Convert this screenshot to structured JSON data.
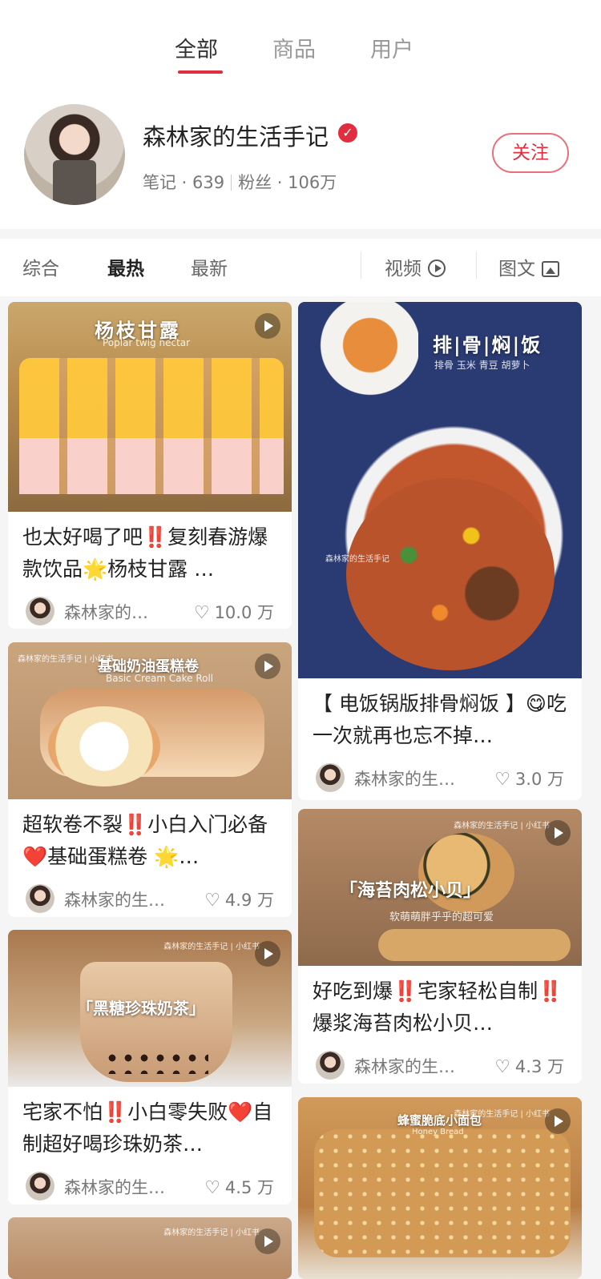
{
  "top_tabs": [
    "全部",
    "商品",
    "用户"
  ],
  "user": {
    "name": "森林家的生活手记",
    "verified_icon": "✓",
    "notes_label": "笔记 · 639",
    "fans_label": "粉丝 · 106万",
    "follow_label": "关注"
  },
  "sort": {
    "items": [
      "综合",
      "最热",
      "最新"
    ],
    "video_label": "视频",
    "image_text_label": "图文"
  },
  "cards": [
    {
      "cover_title": "杨枝甘露",
      "cover_sub": "Poplar twig nectar",
      "title": "也太好喝了吧‼️复刻春游爆款饮品🌟杨枝甘露 …",
      "author": "森林家的…",
      "likes": "10.0 万"
    },
    {
      "cover_title": "排|骨|焖|饭",
      "cover_sub": "排骨  玉米  青豆  胡萝卜",
      "cover_tag": "森林家的生活手记",
      "title": "【 电饭锅版排骨焖饭 】😋吃一次就再也忘不掉…",
      "author": "森林家的生…",
      "likes": "3.0 万"
    },
    {
      "cover_title": "基础奶油蛋糕卷",
      "cover_sub": "Basic Cream Cake Roll",
      "cover_tag": "森林家的生活手记 | 小红书",
      "title": "超软卷不裂‼️小白入门必备❤️基础蛋糕卷 🌟…",
      "author": "森林家的生…",
      "likes": "4.9 万"
    },
    {
      "cover_title": "「海苔肉松小贝」",
      "cover_sub": "软萌萌胖乎乎的超可爱",
      "cover_tag": "森林家的生活手记 | 小红书",
      "title": "好吃到爆‼️宅家轻松自制‼️爆浆海苔肉松小贝…",
      "author": "森林家的生…",
      "likes": "4.3 万"
    },
    {
      "cover_title": "「黑糖珍珠奶茶」",
      "cover_tag": "森林家的生活手记 | 小红书",
      "title": "宅家不怕‼️小白零失败❤️自制超好喝珍珠奶茶…",
      "author": "森林家的生…",
      "likes": "4.5 万"
    },
    {
      "cover_title": "蜂蜜脆底小面包",
      "cover_sub": "Honey Bread",
      "cover_tag": "森林家的生活手记 | 小红书"
    },
    {
      "cover_tag": "森林家的生活手记 | 小红书"
    }
  ],
  "colors": {
    "accent": "#e02e3e",
    "feed_bg": "#f5f5f5"
  },
  "icons": {
    "heart": "♡",
    "play": "play-icon",
    "image": "image-icon"
  }
}
